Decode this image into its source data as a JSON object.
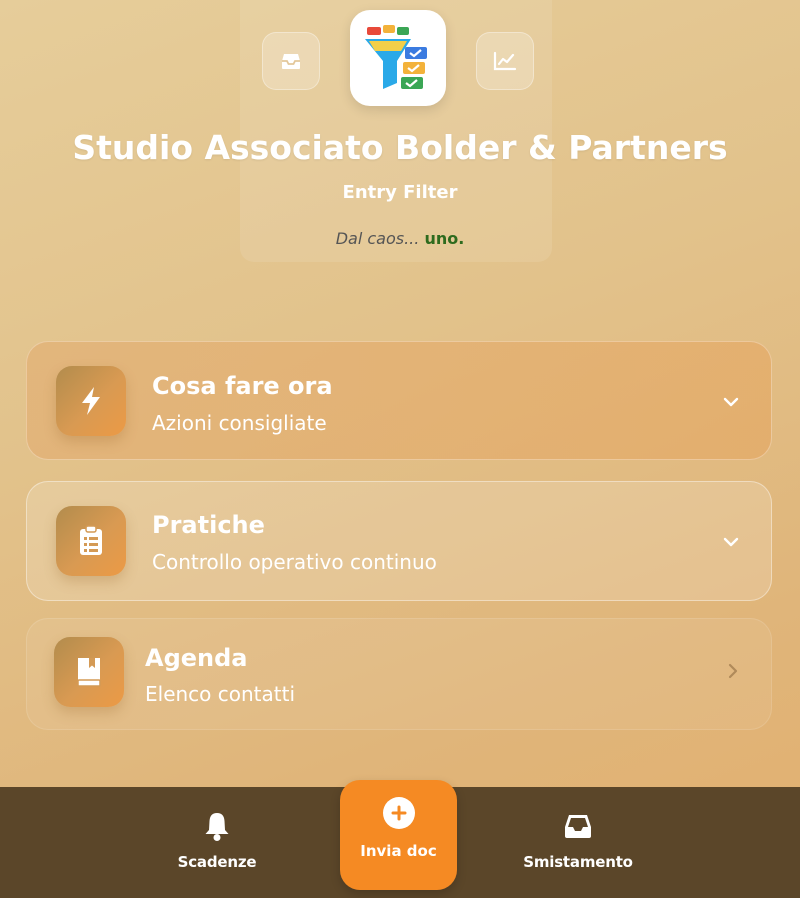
{
  "header": {
    "studio_name": "Studio Associato Bolder & Partners",
    "app_name": "Entry Filter",
    "tagline_lead": "Dal caos...",
    "tagline_accent": "uno.",
    "left_button_icon": "inbox-icon",
    "right_button_icon": "chart-line-icon",
    "logo_icon": "funnel-checklist-logo"
  },
  "cards": [
    {
      "title": "Cosa fare ora",
      "subtitle": "Azioni consigliate",
      "icon": "lightning-icon",
      "trailing": "chevron-down-icon"
    },
    {
      "title": "Pratiche",
      "subtitle": "Controllo operativo continuo",
      "icon": "clipboard-list-icon",
      "trailing": "chevron-down-icon"
    },
    {
      "title": "Agenda",
      "subtitle": "Elenco contatti",
      "icon": "address-book-icon",
      "trailing": "chevron-right-icon"
    }
  ],
  "bottom_nav": {
    "scadenze": {
      "label": "Scadenze",
      "icon": "bell-icon"
    },
    "invia_doc": {
      "label": "Invia doc",
      "icon": "plus-circle-icon"
    },
    "smistamento": {
      "label": "Smistamento",
      "icon": "inbox-tray-icon"
    }
  },
  "colors": {
    "accent_orange": "#f58a23",
    "bottom_bar": "#5b4629",
    "tagline_accent": "#2e6b1e",
    "icon_gradient_start": "#b28c4d",
    "icon_gradient_end": "#ec9a45"
  }
}
